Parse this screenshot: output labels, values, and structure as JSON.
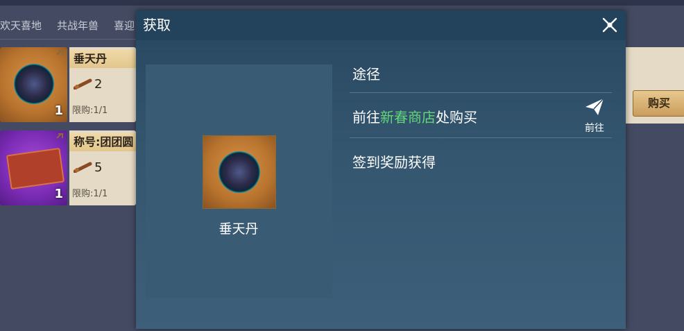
{
  "background": {
    "tabs": [
      "欢天喜地",
      "共战年兽",
      "喜迎"
    ],
    "items": [
      {
        "name": "垂天丹",
        "cost": "2",
        "limit": "限购:1/1",
        "qty": "1"
      },
      {
        "name": "称号:团团圆",
        "cost": "5",
        "limit": "限购:1/1",
        "qty": "1"
      }
    ],
    "buy_label": "购买"
  },
  "modal": {
    "title": "获取",
    "item_name": "垂天丹",
    "route_title": "途径",
    "route1": {
      "prefix": "前往",
      "highlight": "新春商店",
      "suffix": "处购买",
      "button_label": "前往"
    },
    "route2": {
      "text": "签到奖励获得"
    }
  },
  "colors": {
    "highlight": "#62d67a",
    "modal_bg": "#2b4a63"
  }
}
